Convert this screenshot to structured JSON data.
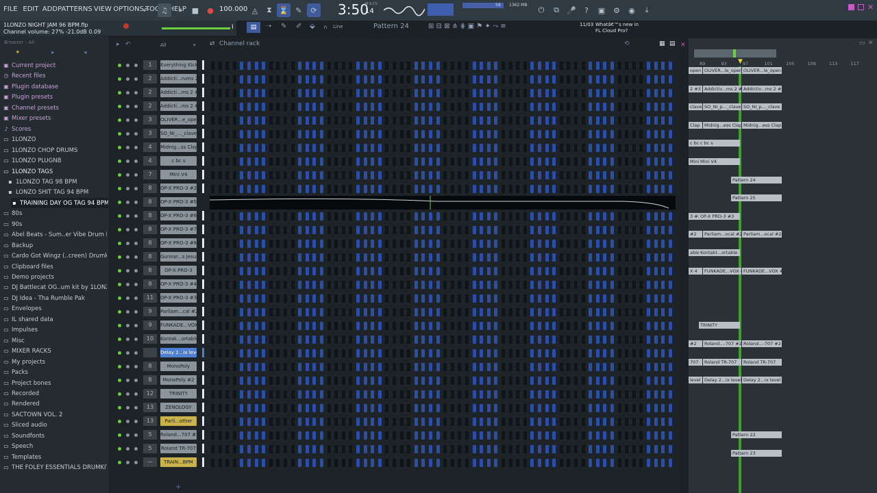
{
  "menus": [
    "FILE",
    "EDIT",
    "ADD",
    "PATTERNS",
    "VIEW",
    "OPTIONS",
    "TOOLS",
    "HELP"
  ],
  "transport": {
    "tempo": "100.000",
    "time": "3:50",
    "time_small": "14",
    "time_unit": "M:S:CS",
    "pattern": "Pattern 24",
    "line_mode": "Line"
  },
  "hint": {
    "project": "1LONZO NIGHT JAM 96 BPM.flp",
    "status": "Channel volume: 27%  -21.0dB  0.09"
  },
  "news": {
    "date": "11/03",
    "text": "Whatâ€™s new in FL Cloud Pro?"
  },
  "cpu": {
    "memory": "1362 MB",
    "value": "58"
  },
  "browser": {
    "header": "Browser - All",
    "items": [
      {
        "icon": "▣",
        "label": "Current project",
        "color": "#c9a2d8"
      },
      {
        "icon": "◷",
        "label": "Recent files",
        "color": "#c9a2d8"
      },
      {
        "icon": "▣",
        "label": "Plugin database",
        "color": "#c9a2d8"
      },
      {
        "icon": "▣",
        "label": "Plugin presets",
        "color": "#c9a2d8"
      },
      {
        "icon": "▣",
        "label": "Channel presets",
        "color": "#c9a2d8"
      },
      {
        "icon": "▣",
        "label": "Mixer presets",
        "color": "#c9a2d8"
      },
      {
        "icon": "♪",
        "label": "Scores",
        "color": "#c9a2d8"
      },
      {
        "icon": "▭",
        "label": "1LONZO",
        "color": "#c5cdd4"
      },
      {
        "icon": "▭",
        "label": "1LONZO CHOP DRUMS",
        "color": "#c5cdd4"
      },
      {
        "icon": "▭",
        "label": "1LONZO PLUGNB",
        "color": "#c5cdd4"
      },
      {
        "icon": "▭",
        "label": "1LONZO TAGS",
        "color": "#e6ebef"
      },
      {
        "icon": "▪",
        "label": "1LONZO TAG 98 BPM",
        "color": "#c5cdd4"
      },
      {
        "icon": "▪",
        "label": "LONZO SHIT TAG 94 BPM",
        "color": "#c5cdd4"
      },
      {
        "icon": "▪",
        "label": "TRAINING DAY OG TAG 94 BPM",
        "color": "#ffffff"
      },
      {
        "icon": "▭",
        "label": "80s",
        "color": "#c5cdd4"
      },
      {
        "icon": "▭",
        "label": "90s",
        "color": "#c5cdd4"
      },
      {
        "icon": "▭",
        "label": "Abel Beats - Sum..er Vibe Drum Kit",
        "color": "#c5cdd4"
      },
      {
        "icon": "▭",
        "label": "Backup",
        "color": "#c5cdd4"
      },
      {
        "icon": "▭",
        "label": "Cardo Got Wingz (..creen) Drumkit",
        "color": "#c5cdd4"
      },
      {
        "icon": "▭",
        "label": "Clipboard files",
        "color": "#c5cdd4"
      },
      {
        "icon": "▭",
        "label": "Demo projects",
        "color": "#c5cdd4"
      },
      {
        "icon": "▭",
        "label": "DJ Battlecat OG..um kit by 1LONZO",
        "color": "#c5cdd4"
      },
      {
        "icon": "▭",
        "label": "DJ Idea - Tha Rumble Pak",
        "color": "#c5cdd4"
      },
      {
        "icon": "▭",
        "label": "Envelopes",
        "color": "#c5cdd4"
      },
      {
        "icon": "▭",
        "label": "IL shared data",
        "color": "#c5cdd4"
      },
      {
        "icon": "▭",
        "label": "Impulses",
        "color": "#c5cdd4"
      },
      {
        "icon": "▭",
        "label": "Misc",
        "color": "#c5cdd4"
      },
      {
        "icon": "▭",
        "label": "MIXER RACKS",
        "color": "#c5cdd4"
      },
      {
        "icon": "▭",
        "label": "My projects",
        "color": "#c5cdd4"
      },
      {
        "icon": "▭",
        "label": "Packs",
        "color": "#c5cdd4"
      },
      {
        "icon": "▭",
        "label": "Project bones",
        "color": "#c5cdd4"
      },
      {
        "icon": "▭",
        "label": "Recorded",
        "color": "#c5cdd4"
      },
      {
        "icon": "▭",
        "label": "Rendered",
        "color": "#c5cdd4"
      },
      {
        "icon": "▭",
        "label": "SACTOWN VOL. 2",
        "color": "#c5cdd4"
      },
      {
        "icon": "▭",
        "label": "Sliced audio",
        "color": "#c5cdd4"
      },
      {
        "icon": "▭",
        "label": "Soundfonts",
        "color": "#c5cdd4"
      },
      {
        "icon": "▭",
        "label": "Speech",
        "color": "#c5cdd4"
      },
      {
        "icon": "▭",
        "label": "Templates",
        "color": "#c5cdd4"
      },
      {
        "icon": "▭",
        "label": "THE FOLEY ESSENTIALS DRUMKIT",
        "color": "#c5cdd4"
      }
    ]
  },
  "rack": {
    "title": "Channel rack",
    "filter": "All",
    "channels": [
      {
        "num": "1",
        "name": "Everything Kick"
      },
      {
        "num": "2",
        "name": "Addicti...rums 2"
      },
      {
        "num": "2",
        "name": "Addicti...ms 2 #2"
      },
      {
        "num": "2",
        "name": "Addicti...ms 2 #3"
      },
      {
        "num": "3",
        "name": "OLIVER...e_open"
      },
      {
        "num": "3",
        "name": "SO_NI_..._clave"
      },
      {
        "num": "4",
        "name": "Midnig...ss Clap"
      },
      {
        "num": "4",
        "name": "c bc s"
      },
      {
        "num": "7",
        "name": "Mini V4"
      },
      {
        "num": "8",
        "name": "OP-X PRO-3 #2"
      },
      {
        "num": "8",
        "name": "OP-X PRO-3 #5"
      },
      {
        "num": "8",
        "name": "OP-X PRO-3 #6"
      },
      {
        "num": "8",
        "name": "OP-X PRO-3 #7"
      },
      {
        "num": "8",
        "name": "OP-X PRO-3 #8"
      },
      {
        "num": "8",
        "name": "Gunnar...s Jesus"
      },
      {
        "num": "8",
        "name": "OP-X PRO-3"
      },
      {
        "num": "8",
        "name": "OP-X PRO-3 #4"
      },
      {
        "num": "11",
        "name": "OP-X PRO-3 #3"
      },
      {
        "num": "9",
        "name": "Parliam...cal #2"
      },
      {
        "num": "9",
        "name": "FUNKADE...VOX 4"
      },
      {
        "num": "10",
        "name": "Kontak...ortable"
      },
      {
        "num": "",
        "name": "Delay 2...ix level"
      },
      {
        "num": "8",
        "name": "MonoPoly"
      },
      {
        "num": "8",
        "name": "MonoPoly #2"
      },
      {
        "num": "12",
        "name": "TRINITY"
      },
      {
        "num": "13",
        "name": "ZENOLOGY"
      },
      {
        "num": "13",
        "name": "Parli...other"
      },
      {
        "num": "5",
        "name": "Roland...707 #2"
      },
      {
        "num": "5",
        "name": "Roland TR-707"
      },
      {
        "num": "—",
        "name": "TRAIN...BPM"
      }
    ]
  },
  "playlist": {
    "ruler": [
      "89",
      "93",
      "97",
      "101",
      "105",
      "109",
      "113",
      "117"
    ],
    "clips": [
      {
        "row": 0,
        "label": "open"
      },
      {
        "row": 0,
        "label": "OLIVER...le_open"
      },
      {
        "row": 0,
        "label": "OLIVER...le_open"
      },
      {
        "row": 1,
        "label": "2 #3"
      },
      {
        "row": 1,
        "label": "Addictiv...ms 2 #3"
      },
      {
        "row": 1,
        "label": "Addictiv...ms 2 #3"
      },
      {
        "row": 2,
        "label": "clave"
      },
      {
        "row": 2,
        "label": "SO_NI_p..._clave"
      },
      {
        "row": 2,
        "label": "SO_NI_p..._clave"
      },
      {
        "row": 3,
        "label": "Clap"
      },
      {
        "row": 3,
        "label": "Midnig...ess Clap"
      },
      {
        "row": 3,
        "label": "Midnig...ess Clap"
      },
      {
        "row": 4,
        "label": "c bc s"
      },
      {
        "row": 4,
        "label": "c bc s"
      },
      {
        "row": 5,
        "label": "Mini V4"
      },
      {
        "row": 5,
        "label": "Mini V4"
      },
      {
        "row": 6,
        "label": "Pattern 24"
      },
      {
        "row": 7,
        "label": "Pattern 25"
      },
      {
        "row": 8,
        "label": "3 #3"
      },
      {
        "row": 8,
        "label": "OP-X PRO-3 #3"
      },
      {
        "row": 9,
        "label": "#2"
      },
      {
        "row": 9,
        "label": "Parliam...ocal #2"
      },
      {
        "row": 9,
        "label": "Parliam...ocal #2"
      },
      {
        "row": 10,
        "label": "able"
      },
      {
        "row": 10,
        "label": "Kontakt...ortable"
      },
      {
        "row": 11,
        "label": "X 4"
      },
      {
        "row": 11,
        "label": "FUNKADE...VOX 4"
      },
      {
        "row": 11,
        "label": "FUNKADE...VOX 4"
      },
      {
        "row": 14,
        "label": "TRINITY"
      },
      {
        "row": 15,
        "label": "#2"
      },
      {
        "row": 15,
        "label": "Roland...-707 #2"
      },
      {
        "row": 15,
        "label": "Roland...-707 #2"
      },
      {
        "row": 16,
        "label": "707"
      },
      {
        "row": 16,
        "label": "Roland TR-707"
      },
      {
        "row": 16,
        "label": "Roland TR-707"
      },
      {
        "row": 17,
        "label": "level"
      },
      {
        "row": 17,
        "label": "Delay 2...ix level"
      },
      {
        "row": 17,
        "label": "Delay 2...ix level"
      },
      {
        "row": 20,
        "label": "Pattern 22"
      },
      {
        "row": 21,
        "label": "Pattern 23"
      }
    ]
  },
  "colors": {
    "step_on": "#2b4fa8",
    "step_off": "#0f1418",
    "accent": "#4f7fd0",
    "playhead": "#6fcf43"
  }
}
